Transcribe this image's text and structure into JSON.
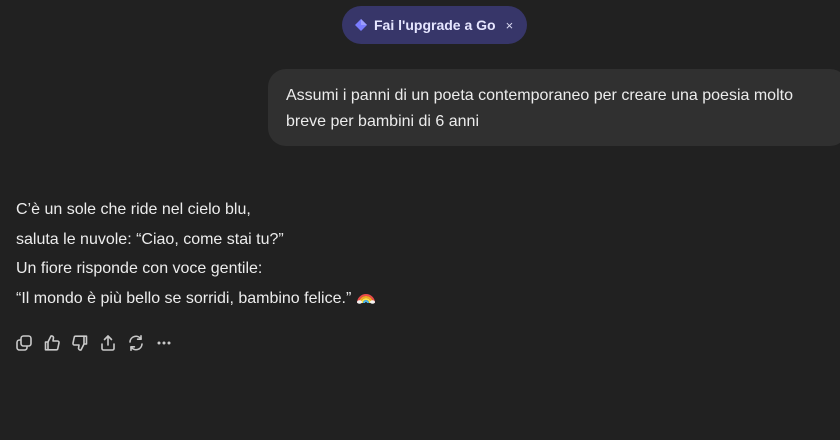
{
  "upgrade_banner": {
    "label": "Fai l'upgrade a Go",
    "close_glyph": "×",
    "accent_color": "#7a7cff",
    "icon": "diamond-icon"
  },
  "conversation": {
    "user_message": "Assumi i panni di un poeta contemporaneo per creare una poesia molto breve per bambini di 6 anni",
    "assistant_message": {
      "lines": [
        "C’è un sole che ride nel cielo blu,",
        "saluta le nuvole: “Ciao, come stai tu?”",
        "Un fiore risponde con voce gentile:",
        "“Il mondo è più bello se sorridi, bambino felice.”"
      ],
      "trailing_icon": "rainbow-icon"
    },
    "actions": [
      {
        "icon": "copy-icon"
      },
      {
        "icon": "thumbs-up-icon"
      },
      {
        "icon": "thumbs-down-icon"
      },
      {
        "icon": "share-icon"
      },
      {
        "icon": "regenerate-icon"
      },
      {
        "icon": "more-icon"
      }
    ]
  }
}
